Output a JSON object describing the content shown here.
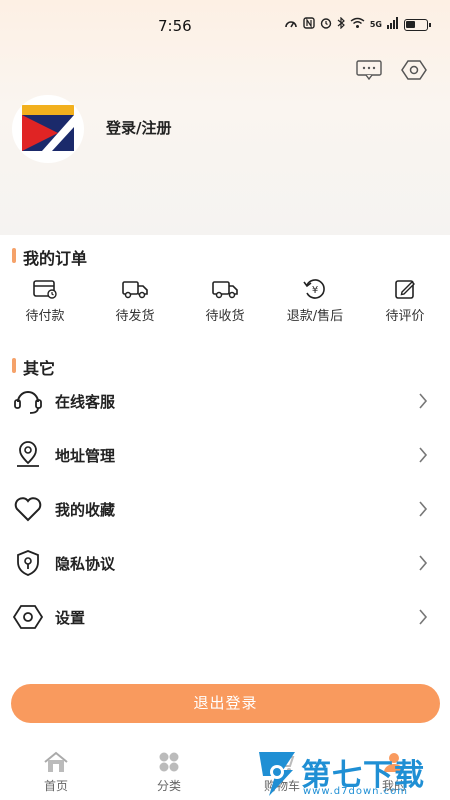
{
  "status_bar": {
    "time": "7:56",
    "network_label": "5G"
  },
  "header": {
    "message_icon": "message-icon",
    "settings_icon": "hexagon-settings-icon",
    "login_text": "登录/注册"
  },
  "orders_section": {
    "title": "我的订单",
    "items": [
      {
        "label": "待付款",
        "icon": "wallet-icon"
      },
      {
        "label": "待发货",
        "icon": "truck-icon"
      },
      {
        "label": "待收货",
        "icon": "delivery-truck-icon"
      },
      {
        "label": "退款/售后",
        "icon": "refund-icon"
      },
      {
        "label": "待评价",
        "icon": "edit-icon"
      }
    ]
  },
  "other_section": {
    "title": "其它",
    "items": [
      {
        "label": "在线客服",
        "icon": "headset-icon"
      },
      {
        "label": "地址管理",
        "icon": "location-icon"
      },
      {
        "label": "我的收藏",
        "icon": "heart-icon"
      },
      {
        "label": "隐私协议",
        "icon": "shield-lock-icon"
      },
      {
        "label": "设置",
        "icon": "hexagon-settings-icon"
      }
    ]
  },
  "logout_button": "退出登录",
  "tab_bar": {
    "tabs": [
      {
        "label": "首页",
        "icon": "home-icon"
      },
      {
        "label": "分类",
        "icon": "category-icon"
      },
      {
        "label": "购物车",
        "icon": "cart-icon"
      },
      {
        "label": "我的",
        "icon": "user-icon"
      }
    ]
  },
  "watermark": {
    "title": "第七下载站",
    "url": "www.d7down.com"
  },
  "colors": {
    "accent": "#f99a5e",
    "section_marker": "#f5a26a",
    "watermark_blue": "#1f8fd4"
  }
}
